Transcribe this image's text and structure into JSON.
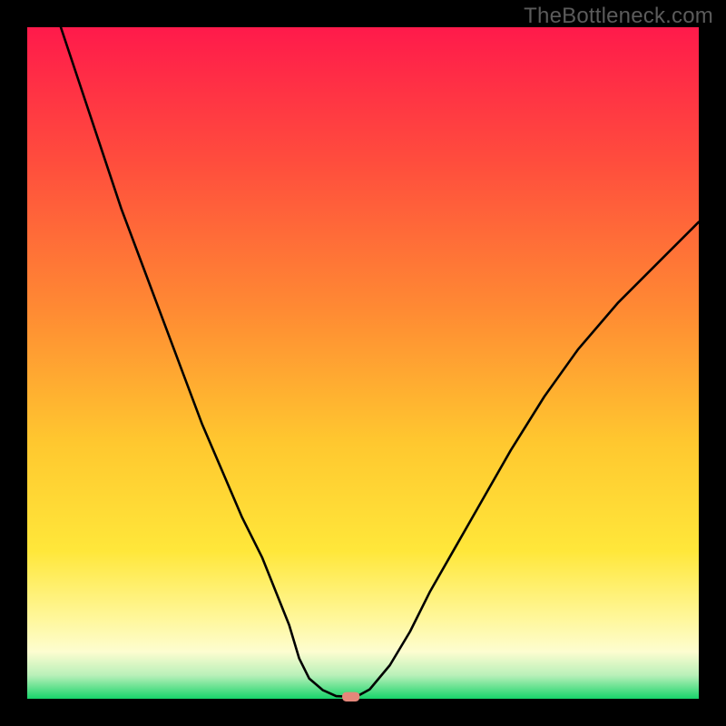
{
  "watermark": "TheBottleneck.com",
  "chart_data": {
    "type": "line",
    "title": "",
    "xlabel": "",
    "ylabel": "",
    "xlim": [
      0,
      100
    ],
    "ylim": [
      0,
      100
    ],
    "grid": false,
    "legend": false,
    "background_gradient": {
      "stops": [
        {
          "offset": 0.0,
          "color": "#ff1a4b"
        },
        {
          "offset": 0.2,
          "color": "#ff4d3d"
        },
        {
          "offset": 0.42,
          "color": "#ff8a33"
        },
        {
          "offset": 0.62,
          "color": "#ffc82f"
        },
        {
          "offset": 0.78,
          "color": "#ffe73a"
        },
        {
          "offset": 0.88,
          "color": "#fff79a"
        },
        {
          "offset": 0.93,
          "color": "#fdfdd0"
        },
        {
          "offset": 0.965,
          "color": "#b9f0b9"
        },
        {
          "offset": 1.0,
          "color": "#17d46a"
        }
      ]
    },
    "series": [
      {
        "name": "bottleneck-curve",
        "color": "#000000",
        "stroke_width": 2.6,
        "x": [
          5,
          8,
          11,
          14,
          17,
          20,
          23,
          26,
          29,
          32,
          35,
          37,
          39,
          40.5,
          42,
          44,
          46,
          48,
          49,
          51,
          54,
          57,
          60,
          64,
          68,
          72,
          77,
          82,
          88,
          95,
          100
        ],
        "values": [
          100,
          91,
          82,
          73,
          65,
          57,
          49,
          41,
          34,
          27,
          21,
          16,
          11,
          6,
          3,
          1.3,
          0.4,
          0.3,
          0.3,
          1.4,
          5,
          10,
          16,
          23,
          30,
          37,
          45,
          52,
          59,
          66,
          71
        ]
      }
    ],
    "marker": {
      "name": "optimal-marker",
      "x": 48.2,
      "y": 0.3,
      "width": 2.6,
      "height": 1.4,
      "color": "#e4877a",
      "rx": 0.6
    }
  }
}
